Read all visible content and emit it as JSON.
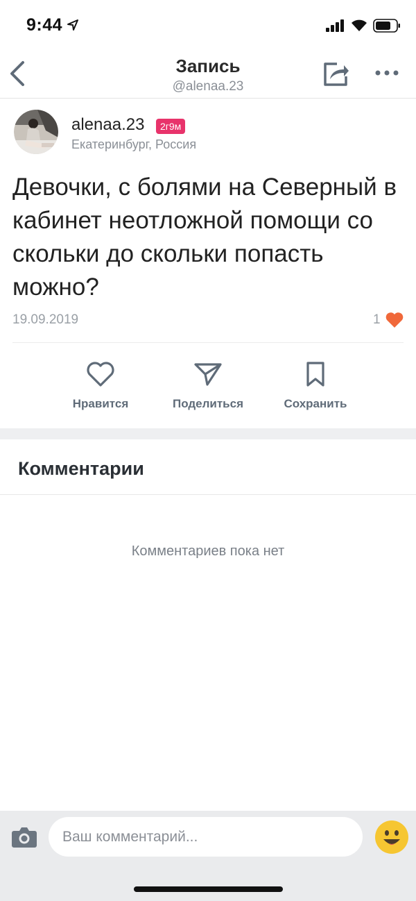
{
  "status_bar": {
    "time": "9:44"
  },
  "nav": {
    "title": "Запись",
    "subtitle": "@alenaa.23"
  },
  "author": {
    "name": "alenaa.23",
    "badge": "2г9м",
    "location": "Екатеринбург, Россия"
  },
  "post": {
    "text": "Девочки, с болями на Северный в кабинет неотложной помощи со скольки до скольки попасть можно?",
    "date": "19.09.2019",
    "likes": "1"
  },
  "actions": {
    "like": "Нравится",
    "share": "Поделиться",
    "save": "Сохранить"
  },
  "comments": {
    "title": "Комментарии",
    "empty": "Комментариев пока нет"
  },
  "composer": {
    "placeholder": "Ваш комментарий..."
  },
  "colors": {
    "badge": "#e8336b",
    "heart": "#f0683a",
    "emoji": "#f6c632"
  },
  "icons": [
    "location-arrow-icon",
    "signal-icon",
    "wifi-icon",
    "battery-icon",
    "back-chevron-icon",
    "share-icon",
    "more-icon",
    "heart-icon",
    "paper-plane-icon",
    "bookmark-icon",
    "camera-icon",
    "emoji-icon"
  ]
}
